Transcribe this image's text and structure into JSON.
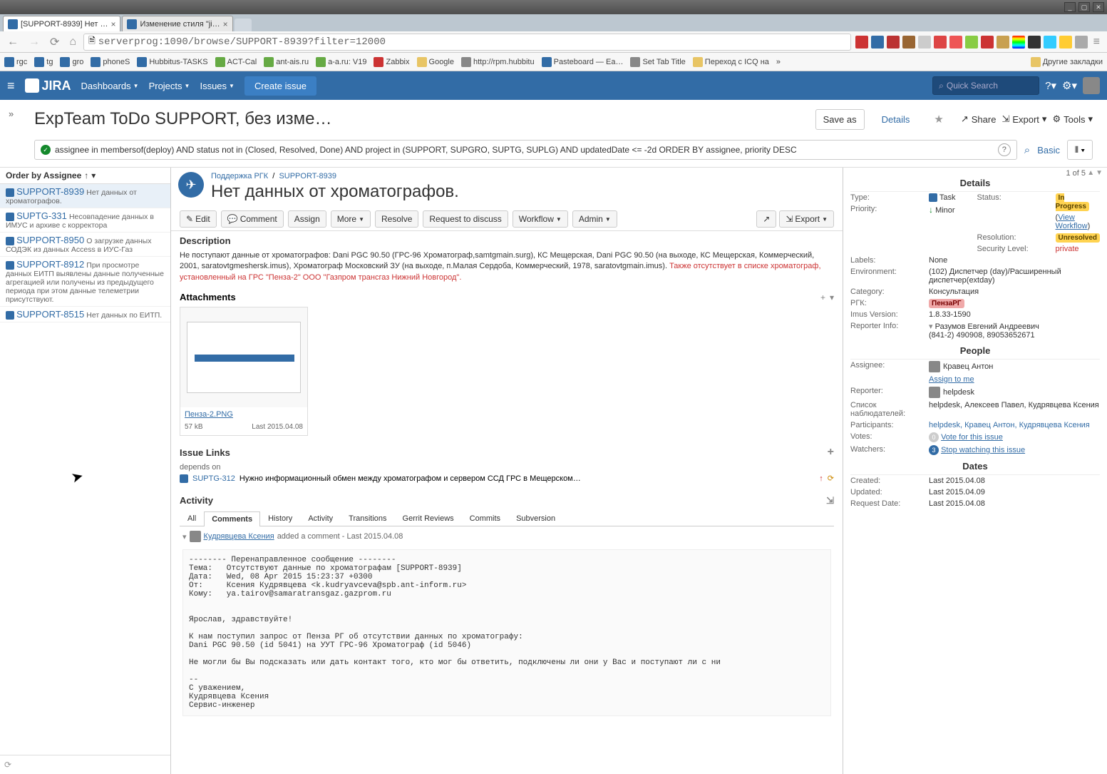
{
  "os": {
    "min": "_",
    "max": "▢",
    "close": "✕"
  },
  "tabs": [
    {
      "title": "[SUPPORT-8939] Нет …",
      "active": true
    },
    {
      "title": "Изменение стиля \"ji…",
      "active": false
    }
  ],
  "url": "serverprog:1090/browse/SUPPORT-8939?filter=12000",
  "bookmarks": [
    "rgc",
    "tg",
    "gro",
    "phoneS",
    "Hubbitus-TASKS",
    "ACT-Cal",
    "ant-ais.ru",
    "a-a.ru: V19",
    "Zabbix",
    "Google",
    "http://rpm.hubbitu",
    "Pasteboard — Ea…",
    "Set Tab Title",
    "Переход с ICQ на",
    "»",
    "Другие закладки"
  ],
  "nav": {
    "dashboards": "Dashboards",
    "projects": "Projects",
    "issues": "Issues",
    "create": "Create issue",
    "search_ph": "Quick Search"
  },
  "filter": {
    "title": "ExpTeam ToDo SUPPORT, без изме…",
    "saveas": "Save as",
    "details": "Details",
    "share": "Share",
    "export": "Export",
    "tools": "Tools",
    "jql": "assignee in membersof(deploy) AND status not in (Closed, Resolved, Done) AND project in (SUPPORT, SUPGRO, SUPTG, SUPLG) AND updatedDate <= -2d ORDER BY assignee, priority DESC",
    "basic": "Basic"
  },
  "order": "Order by Assignee",
  "count": "1 of 5",
  "list": [
    {
      "key": "SUPPORT-8939",
      "sum": "Нет данных от хроматографов."
    },
    {
      "key": "SUPTG-331",
      "sum": "Несовпадение данных в ИМУС и архиве с корректора"
    },
    {
      "key": "SUPPORT-8950",
      "sum": "О загрузке данных СОДЭК из данных Access в ИУС-Газ"
    },
    {
      "key": "SUPPORT-8912",
      "sum": "При просмотре данных ЕИТП выявлены данные полученные агрегацией или получены из предыдущего периода при этом данные телеметрии присутствуют."
    },
    {
      "key": "SUPPORT-8515",
      "sum": "Нет данных по ЕИТП."
    }
  ],
  "issue": {
    "project": "Поддержка РГК",
    "key": "SUPPORT-8939",
    "title": "Нет данных от хроматографов.",
    "edit": "Edit",
    "comment": "Comment",
    "assign": "Assign",
    "more": "More",
    "resolve": "Resolve",
    "rtd": "Request to discuss",
    "workflow": "Workflow",
    "admin": "Admin",
    "export": "Export",
    "desc_label": "Description",
    "desc1": "Не поступают данные от хроматографов: Dani PGC 90.50 (ГРС-96 Хроматограф,samtgmain.surg), КС Мещерская, Dani PGC 90.50 (на выходе, КС Мещерская, Коммерческий, 2001, saratovtgmeshersk.imus), Хроматограф Московский ЗУ (на выходе, п.Малая Сердоба, Коммерческий, 1978, saratovtgmain.imus). ",
    "desc2": "Также отсутствует в списке хроматограф, установленный на ГРС \"Пенза-2\" ООО \"Газпром трансгаз Нижний Новгород\".",
    "attach_label": "Attachments",
    "attach_name": "Пенза-2.PNG",
    "attach_size": "57 kB",
    "attach_date": "Last 2015.04.08",
    "links_label": "Issue Links",
    "depends": "depends on",
    "link_key": "SUPTG-312",
    "link_sum": "Нужно информационный обмен между хроматографом и сервером ССД ГРС в Мещерском…",
    "activity_label": "Activity",
    "act_tabs": [
      "All",
      "Comments",
      "History",
      "Activity",
      "Transitions",
      "Gerrit Reviews",
      "Commits",
      "Subversion"
    ],
    "commenter": "Кудрявцева Ксения",
    "comment_meta": " added a comment - Last 2015.04.08",
    "comment_body": "-------- Перенаправленное сообщение --------\nТема:   Отсутствуют данные по хроматографам [SUPPORT-8939]\nДата:   Wed, 08 Apr 2015 15:23:37 +0300\nОт:     Ксения Кудрявцева <k.kudryavceva@spb.ant-inform.ru>\nКому:   ya.tairov@samaratransgaz.gazprom.ru\n\n\nЯрослав, здравствуйте!\n\nК нам поступил запрос от Пенза РГ об отсутствии данных по хроматографу:\nDani PGC 90.50 (id 5041) на УУТ ГРС-96 Хроматограф (id 5046)\n\nНе могли бы Вы подсказать или дать контакт того, кто мог бы ответить, подключены ли они у Вас и поступают ли с ни\n\n--\nС уважением,\nКудрявцева Ксения\nСервис-инженер"
  },
  "details": {
    "hdr": "Details",
    "type_l": "Type:",
    "type": "Task",
    "status_l": "Status:",
    "status": "In Progress",
    "prio_l": "Priority:",
    "prio": "Minor",
    "view_wf": "View Workflow",
    "res_l": "Resolution:",
    "res": "Unresolved",
    "sec_l": "Security Level:",
    "sec": "private",
    "lab_l": "Labels:",
    "lab": "None",
    "env_l": "Environment:",
    "env": "(102) Диспетчер (day)/Расширенный диспетчер(extday)",
    "cat_l": "Category:",
    "cat": "Консультация",
    "rgk_l": "РГК:",
    "rgk": "ПензаРГ",
    "ver_l": "Imus Version:",
    "ver": "1.8.33-1590",
    "rep_l": "Reporter Info:",
    "rep": "Разумов Евгений Андреевич\n(841-2) 490908, 89053652671",
    "people_hdr": "People",
    "assignee_l": "Assignee:",
    "assignee": "Кравец Антон",
    "assign_me": "Assign to me",
    "reporter_l": "Reporter:",
    "reporter": "helpdesk",
    "watch_l": "Список наблюдателей:",
    "watch": "helpdesk, Алексеев Павел, Кудрявцева Ксения",
    "part_l": "Participants:",
    "part": "helpdesk, Кравец Антон, Кудрявцева Ксения",
    "votes_l": "Votes:",
    "votes_n": "0",
    "vote": "Vote for this issue",
    "watchers_l": "Watchers:",
    "watchers_n": "3",
    "stop_watch": "Stop watching this issue",
    "dates_hdr": "Dates",
    "created_l": "Created:",
    "created": "Last 2015.04.08",
    "updated_l": "Updated:",
    "updated": "Last 2015.04.09",
    "reqdate_l": "Request Date:",
    "reqdate": "Last 2015.04.08"
  }
}
